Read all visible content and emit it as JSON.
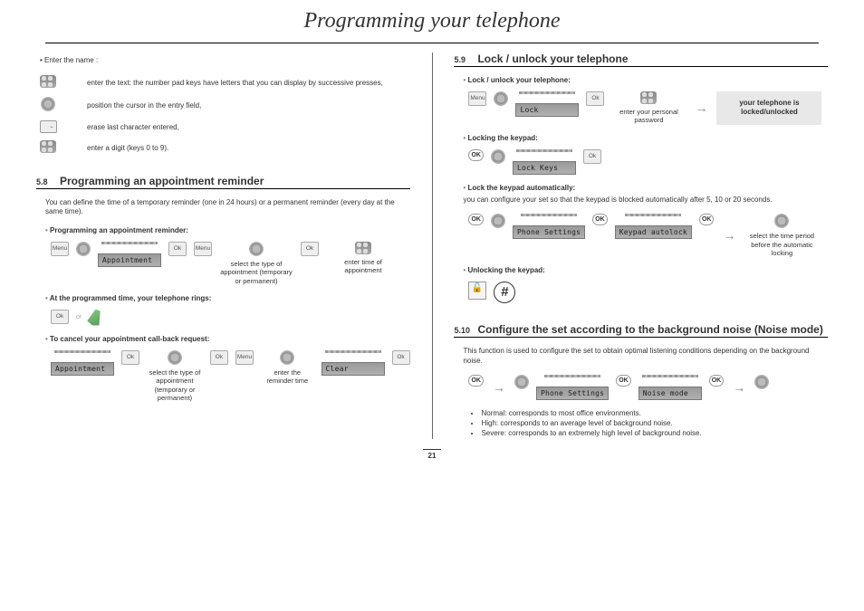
{
  "title": "Programming your telephone",
  "page_number": "21",
  "enter_name": {
    "intro": "• Enter the name :",
    "rows": [
      "enter the text: the number pad keys have letters that you can display by successive presses,",
      "position the cursor in the entry field,",
      "erase last character entered,",
      "enter a digit (keys 0 to 9)."
    ]
  },
  "s58": {
    "num": "5.8",
    "title": "Programming an appointment reminder",
    "intro": "You can define the time of a temporary reminder (one in 24 hours) or a permanent reminder (every day at the same time).",
    "sub1": "Programming an appointment reminder:",
    "lcd1": "Appointment",
    "cap_type": "select the type of appointment (temporary or permanent)",
    "cap_time": "enter time of appointment",
    "sub2": "At the programmed time, your telephone rings:",
    "sub3": "To cancel your appointment call-back request:",
    "lcd2": "Appointment",
    "lcd3": "Clear",
    "cap_type2": "select the type of appointment (temporary or permanent)",
    "cap_rem": "enter the reminder time"
  },
  "s59": {
    "num": "5.9",
    "title": "Lock / unlock your telephone",
    "sub1": "Lock / unlock your telephone:",
    "lcd_lock": "Lock",
    "cap_pw": "enter your personal password",
    "result": "your telephone is locked/unlocked",
    "sub2": "Locking the keypad:",
    "lcd_lockkeys": "Lock Keys",
    "sub3": "Lock the keypad automatically:",
    "auto_desc": "you can configure your set so that the keypad is blocked automatically after 5, 10 or 20 seconds.",
    "lcd_phoneset": "Phone Settings",
    "lcd_autolock": "Keypad autolock",
    "cap_period": "select the time period before the automatic locking",
    "sub4": "Unlocking the keypad:"
  },
  "s510": {
    "num": "5.10",
    "title": "Configure the set according to the background noise (Noise mode)",
    "intro": "This function is used to configure the set to obtain optimal listening conditions depending on the background noise.",
    "lcd_phoneset": "Phone Settings",
    "lcd_noise": "Noise mode",
    "bullets": [
      "Normal: corresponds to most office environments.",
      "High: corresponds to an average level of background noise.",
      "Severe: corresponds to an extremely high level of background noise."
    ]
  },
  "labels": {
    "menu": "Menu",
    "ok": "OK",
    "ok_sm": "Ok"
  }
}
